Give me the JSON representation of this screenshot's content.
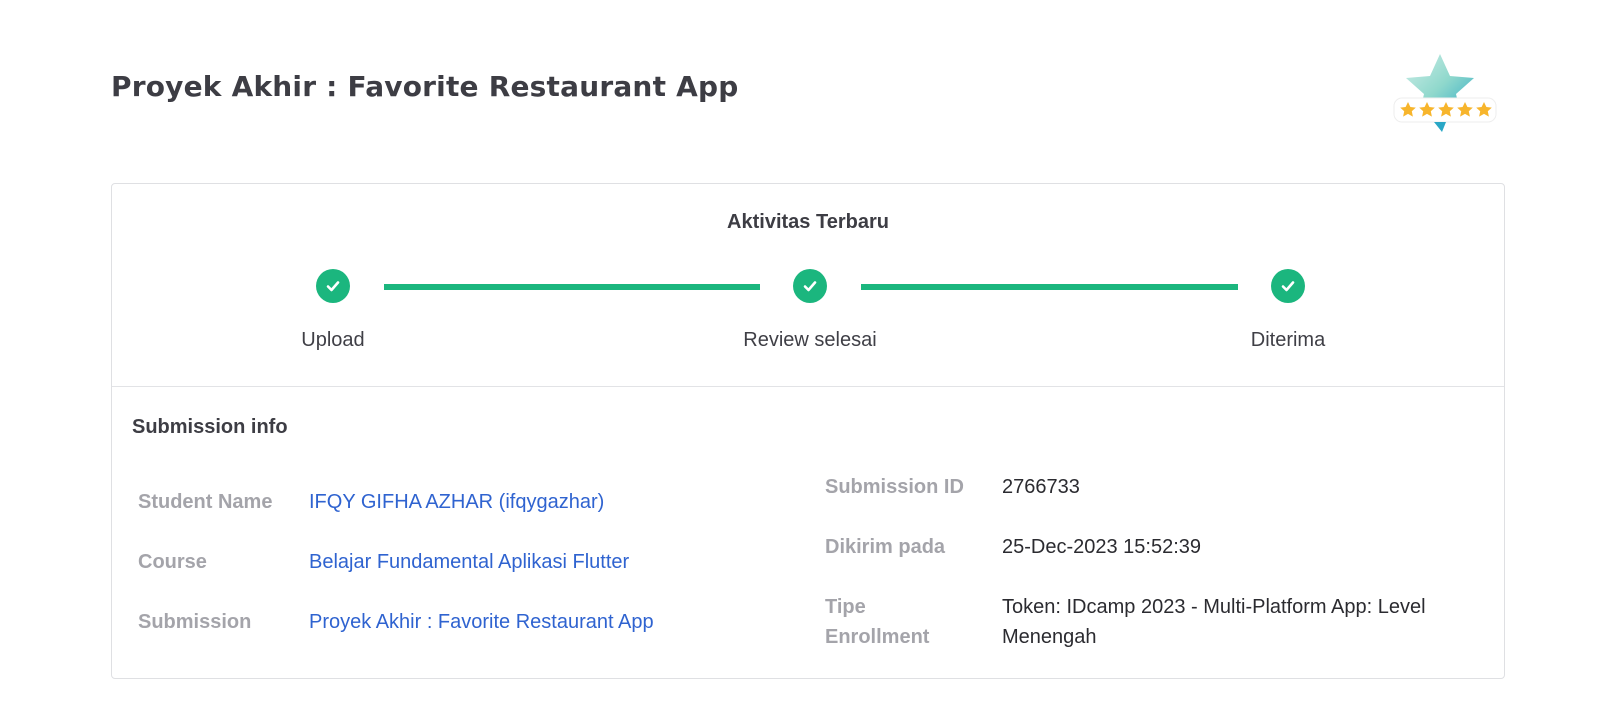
{
  "page": {
    "title": "Proyek Akhir : Favorite Restaurant App"
  },
  "badge": {
    "icon": "star-rating-badge-icon",
    "rating_stars": 5,
    "colors": {
      "star": "#f7b52c",
      "badge": "#7fd3c6"
    }
  },
  "activity": {
    "title": "Aktivitas Terbaru",
    "accent_color": "#1bb67e",
    "steps": [
      {
        "label": "Upload",
        "status": "done"
      },
      {
        "label": "Review selesai",
        "status": "done"
      },
      {
        "label": "Diterima",
        "status": "done"
      }
    ]
  },
  "submission_info": {
    "heading": "Submission info",
    "left": [
      {
        "label": "Student Name",
        "value": "IFQY GIFHA AZHAR (ifqygazhar)"
      },
      {
        "label": "Course",
        "value": "Belajar Fundamental Aplikasi Flutter"
      },
      {
        "label": "Submission",
        "value": "Proyek Akhir : Favorite Restaurant App"
      }
    ],
    "right": [
      {
        "label": "Submission ID",
        "value": "2766733"
      },
      {
        "label": "Dikirim pada",
        "value": "25-Dec-2023 15:52:39"
      },
      {
        "label_line1": "Tipe",
        "label_line2": "Enrollment",
        "value_line1": "Token: IDcamp 2023 - Multi-Platform App: Level",
        "value_line2": "Menengah"
      }
    ]
  }
}
